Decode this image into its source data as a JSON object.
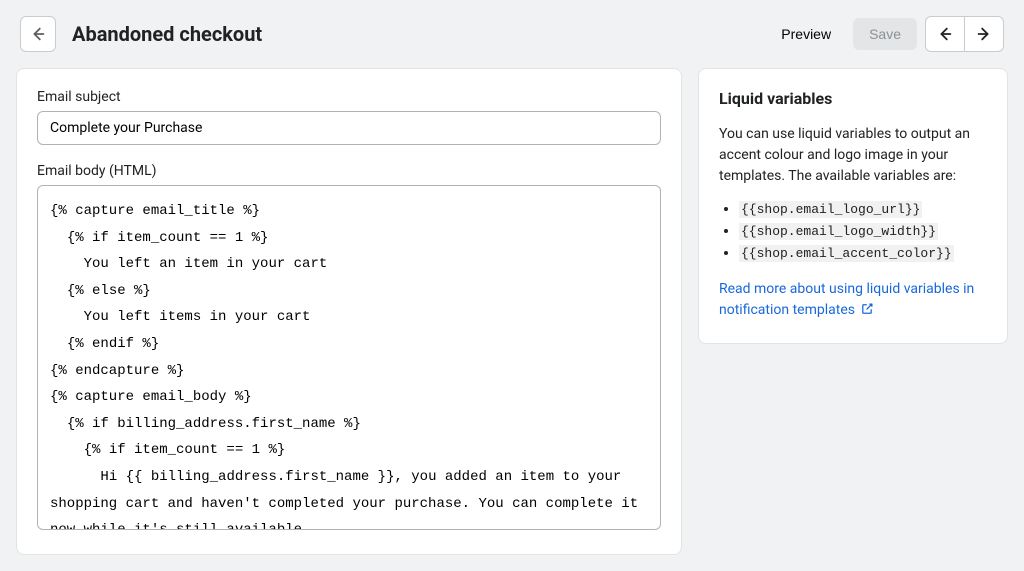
{
  "header": {
    "title": "Abandoned checkout",
    "preview_label": "Preview",
    "save_label": "Save"
  },
  "form": {
    "subject_label": "Email subject",
    "subject_value": "Complete your Purchase",
    "body_label": "Email body (HTML)",
    "body_value": "{% capture email_title %}\n  {% if item_count == 1 %}\n    You left an item in your cart\n  {% else %}\n    You left items in your cart\n  {% endif %}\n{% endcapture %}\n{% capture email_body %}\n  {% if billing_address.first_name %}\n    {% if item_count == 1 %}\n      Hi {{ billing_address.first_name }}, you added an item to your shopping cart and haven't completed your purchase. You can complete it now while it's still available."
  },
  "sidebar": {
    "title": "Liquid variables",
    "description": "You can use liquid variables to output an accent colour and logo image in your templates. The available variables are:",
    "variables": [
      "{{shop.email_logo_url}}",
      "{{shop.email_logo_width}}",
      "{{shop.email_accent_color}}"
    ],
    "link_text": "Read more about using liquid variables in notification templates"
  }
}
